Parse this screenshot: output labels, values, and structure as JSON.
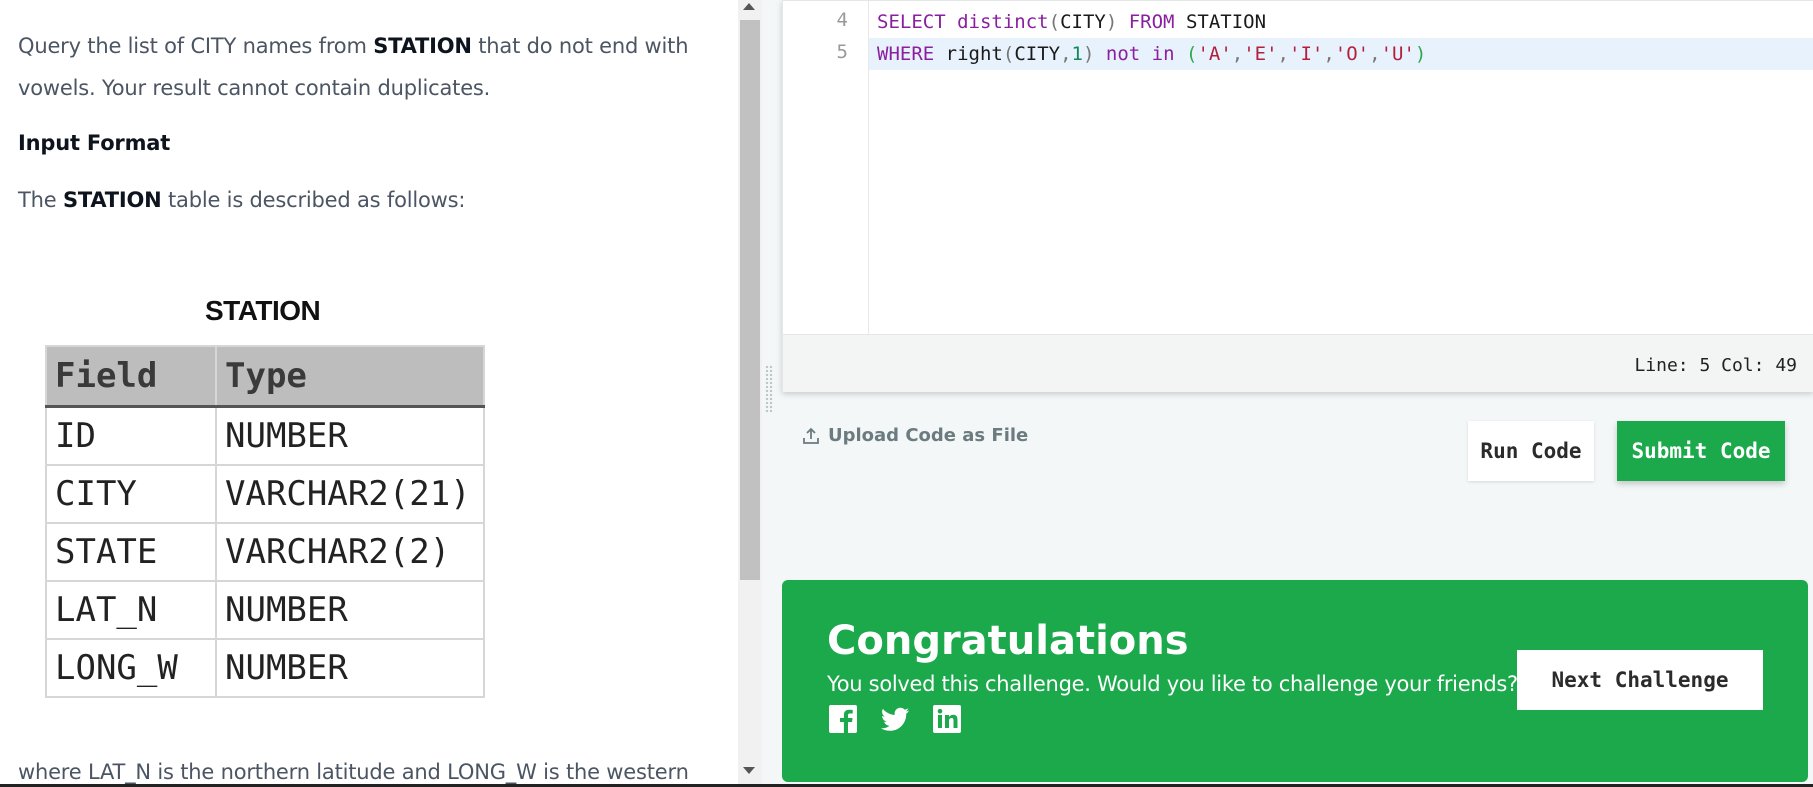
{
  "problem": {
    "intro_line1_pre": "Query the list of CITY names from ",
    "intro_line1_bold": "STATION",
    "intro_line1_post": " that do not end with",
    "intro_line2": "vowels. Your result cannot contain duplicates.",
    "input_format_heading": "Input Format",
    "table_desc_pre": "The ",
    "table_desc_bold": "STATION",
    "table_desc_post": " table is described as follows:",
    "table_title": "STATION",
    "table_headers": [
      "Field",
      "Type"
    ],
    "table_rows": [
      [
        "ID",
        "NUMBER"
      ],
      [
        "CITY",
        "VARCHAR2(21)"
      ],
      [
        "STATE",
        "VARCHAR2(2)"
      ],
      [
        "LAT_N",
        "NUMBER"
      ],
      [
        "LONG_W",
        "NUMBER"
      ]
    ],
    "footer_partial": "where LAT_N is the northern latitude and LONG_W is the western"
  },
  "editor": {
    "lines": [
      {
        "number": "4"
      },
      {
        "number": "5"
      }
    ],
    "code": {
      "l4_kw1": "SELECT",
      "l4_fn": "distinct",
      "l4_arg": "CITY",
      "l4_kw2": "FROM",
      "l4_tbl": "STATION",
      "l5_kw1": "WHERE",
      "l5_fn": "right",
      "l5_arg": "CITY",
      "l5_num": "1",
      "l5_kw2": "not in",
      "l5_vals": [
        "'A'",
        "'E'",
        "'I'",
        "'O'",
        "'U'"
      ]
    },
    "cursor_position": "Line: 5 Col: 49"
  },
  "actions": {
    "upload_label": "Upload Code as File",
    "run_label": "Run Code",
    "submit_label": "Submit Code"
  },
  "congrats": {
    "title": "Congratulations",
    "message": "You solved this challenge. Would you like to challenge your friends?",
    "next_label": "Next Challenge",
    "social_icons": [
      "facebook-icon",
      "twitter-icon",
      "linkedin-icon"
    ]
  },
  "colors": {
    "accent_green": "#1ba94c",
    "keyword_purple": "#8a1fa0",
    "string_red": "#b2203c"
  }
}
